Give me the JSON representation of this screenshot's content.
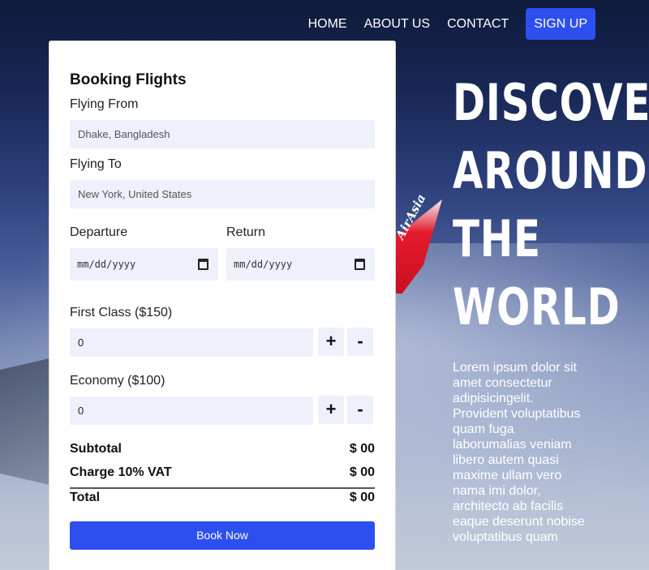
{
  "nav": {
    "items": [
      "HOME",
      "ABOUT US",
      "CONTACT"
    ],
    "signup_label": "SIGN UP"
  },
  "booking": {
    "title": "Booking Flights",
    "from_label": "Flying From",
    "from_placeholder": "Dhake, Bangladesh",
    "to_label": "Flying To",
    "to_placeholder": "New York, United States",
    "departure_label": "Departure",
    "return_label": "Return",
    "date_placeholder": "mm/dd/yyyy",
    "first_class_label": "First Class ($150)",
    "first_class_value": "0",
    "economy_label": "Economy ($100)",
    "economy_value": "0",
    "plus": "+",
    "minus": "-",
    "subtotal_label": "Subtotal",
    "subtotal_value": "$ 00",
    "vat_label": "Charge 10% VAT",
    "vat_value": "$ 00",
    "total_label": "Total",
    "total_value": "$ 00",
    "book_label": "Book Now"
  },
  "hero": {
    "lines": [
      "DISCOVER",
      "AROUND",
      "THE",
      "WORLD"
    ],
    "text": "Lorem ipsum dolor sit amet consectetur adipisicingelit. Provident voluptatibus quam fuga laborumalias veniam libero autem quasi maxime ullam vero nama imi dolor, architecto ab facilis eaque deserunt nobise voluptatibus quam"
  },
  "background": {
    "tail_text": "AirAsia"
  },
  "colors": {
    "accent": "#2e4ff0",
    "field_bg": "#eef0fb"
  }
}
